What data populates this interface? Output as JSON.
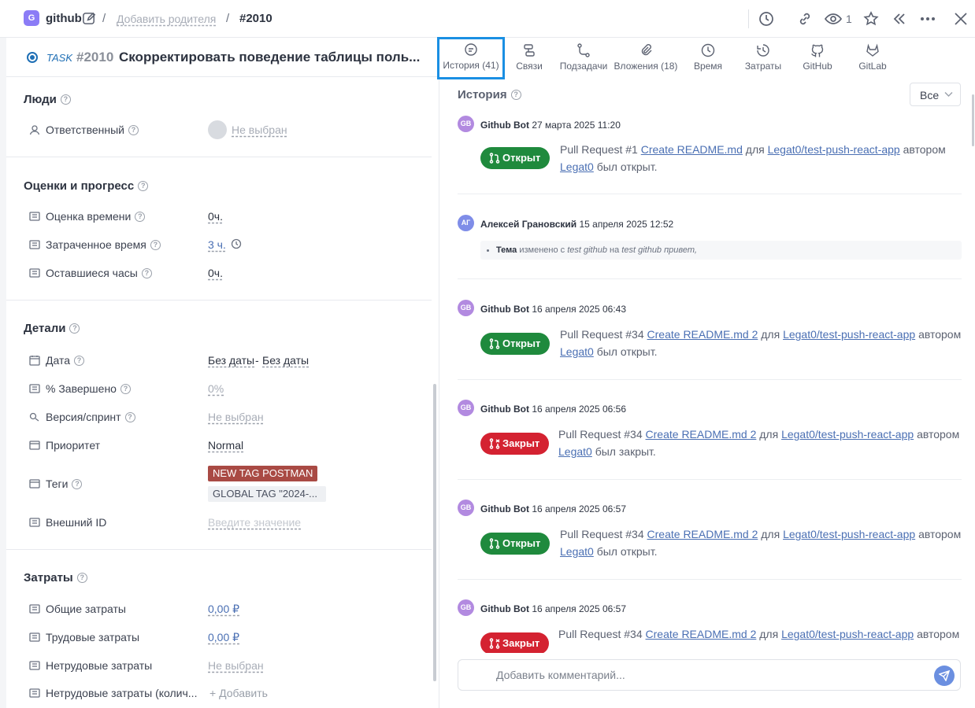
{
  "breadcrumb": {
    "project_initial": "G",
    "project_name": "github",
    "separator": "/",
    "add_parent": "Добавить родителя",
    "task_id": "#2010"
  },
  "toolbar": {
    "watch_count": "1"
  },
  "task": {
    "type": "TASK",
    "number": "#2010",
    "title": "Скорректировать поведение таблицы поль..."
  },
  "left": {
    "people": {
      "title": "Люди",
      "assignee_label": "Ответственный",
      "assignee_value": "Не выбран"
    },
    "estimates": {
      "title": "Оценки и прогресс",
      "rows": [
        {
          "label": "Оценка времени",
          "value": "0ч."
        },
        {
          "label": "Затраченное время",
          "value": "3 ч."
        },
        {
          "label": "Оставшиеся часы",
          "value": "0ч."
        }
      ]
    },
    "details": {
      "title": "Детали",
      "date_label": "Дата",
      "date_start": "Без даты",
      "date_dash": "-",
      "date_end": "Без даты",
      "done_label": "% Завершено",
      "done_value": "0%",
      "version_label": "Версия/спринт",
      "version_value": "Не выбран",
      "priority_label": "Приоритет",
      "priority_value": "Normal",
      "tags_label": "Теги",
      "tag1": "NEW TAG POSTMAN",
      "tag2": "GLOBAL TAG \"2024-...",
      "external_label": "Внешний ID",
      "external_placeholder": "Введите значение"
    },
    "costs": {
      "title": "Затраты",
      "total_label": "Общие затраты",
      "total_value": "0,00 ₽",
      "labor_label": "Трудовые затраты",
      "labor_value": "0,00 ₽",
      "nonlabor_label": "Нетрудовые затраты",
      "nonlabor_value": "Не выбран",
      "nonlabor_qty_label": "Нетрудовые затраты (колич...",
      "add_label": "+ Добавить"
    }
  },
  "tabs": [
    {
      "label": "История (41)"
    },
    {
      "label": "Связи"
    },
    {
      "label": "Подзадачи"
    },
    {
      "label": "Вложения (18)"
    },
    {
      "label": "Время"
    },
    {
      "label": "Затраты"
    },
    {
      "label": "GitHub"
    },
    {
      "label": "GitLab"
    }
  ],
  "history": {
    "title": "История",
    "filter": "Все",
    "events": [
      {
        "avatar": "GB",
        "author": "Github Bot",
        "time": "27 марта 2025 11:20",
        "badge": "Открыт",
        "pr": "Pull Request #1",
        "file": "Create README.md",
        "for": "для",
        "repo": "Legat0/test-push-react-app",
        "by": "автором",
        "user": "Legat0",
        "result": "был открыт."
      },
      {
        "avatar": "АГ",
        "author": "Алексей Грановский",
        "time": "15 апреля 2025 12:52",
        "field": "Тема",
        "changed": "изменено с",
        "from": "test github",
        "to_word": "на",
        "to": "test github привет,"
      },
      {
        "avatar": "GB",
        "author": "Github Bot",
        "time": "16 апреля 2025 06:43",
        "badge": "Открыт",
        "pr": "Pull Request #34",
        "file": "Create README.md 2",
        "for": "для",
        "repo": "Legat0/test-push-react-app",
        "by": "автором",
        "user": "Legat0",
        "result": "был открыт."
      },
      {
        "avatar": "GB",
        "author": "Github Bot",
        "time": "16 апреля 2025 06:56",
        "badge": "Закрыт",
        "pr": "Pull Request #34",
        "file": "Create README.md 2",
        "for": "для",
        "repo": "Legat0/test-push-react-app",
        "by": "автором",
        "user": "Legat0",
        "result": "был закрыт."
      },
      {
        "avatar": "GB",
        "author": "Github Bot",
        "time": "16 апреля 2025 06:57",
        "badge": "Открыт",
        "pr": "Pull Request #34",
        "file": "Create README.md 2",
        "for": "для",
        "repo": "Legat0/test-push-react-app",
        "by": "автором",
        "user": "Legat0",
        "result": "был открыт."
      },
      {
        "avatar": "GB",
        "author": "Github Bot",
        "time": "16 апреля 2025 06:57",
        "badge": "Закрыт",
        "pr": "Pull Request #34",
        "file": "Create README.md 2",
        "for": "для",
        "repo": "Legat0/test-push-react-app",
        "by": "автором"
      }
    ]
  },
  "comment": {
    "placeholder": "Добавить комментарий..."
  },
  "icons": {
    "edit": "pencil-square-icon",
    "history": "clock-icon",
    "link": "link-icon",
    "watch": "eye-icon",
    "favorite": "star-icon",
    "collapse": "double-chevron-left-icon",
    "more": "dots-icon",
    "close": "close-icon",
    "send": "send-icon"
  },
  "colors": {
    "accent": "#1a8fe3",
    "open": "#1f8a3d",
    "closed": "#d42231",
    "tag_red": "#a94a44",
    "link": "#4a6fb3"
  }
}
